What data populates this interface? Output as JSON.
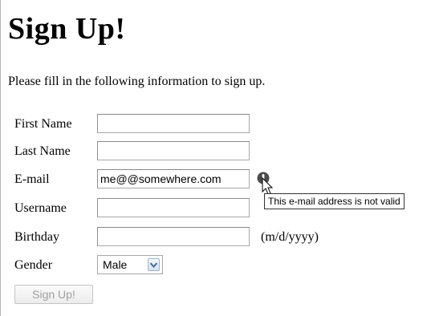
{
  "page": {
    "title": "Sign Up!",
    "intro": "Please fill in the following information to sign up."
  },
  "form": {
    "first_name": {
      "label": "First Name",
      "value": ""
    },
    "last_name": {
      "label": "Last Name",
      "value": ""
    },
    "email": {
      "label": "E-mail",
      "value": "me@@somewhere.com",
      "error_tooltip": "This e-mail address is not valid"
    },
    "username": {
      "label": "Username",
      "value": ""
    },
    "birthday": {
      "label": "Birthday",
      "value": "",
      "hint": "(m/d/yyyy)"
    },
    "gender": {
      "label": "Gender",
      "selected": "Male"
    },
    "submit_label": "Sign Up!"
  },
  "icons": {
    "invalid": "exclamation-circle-icon",
    "cursor": "mouse-pointer-icon",
    "dropdown": "chevron-down-icon"
  },
  "colors": {
    "invalid_icon": "#4a4a4a",
    "disabled_text": "#a0a0a0",
    "select_arrow": "#4b6a97"
  }
}
